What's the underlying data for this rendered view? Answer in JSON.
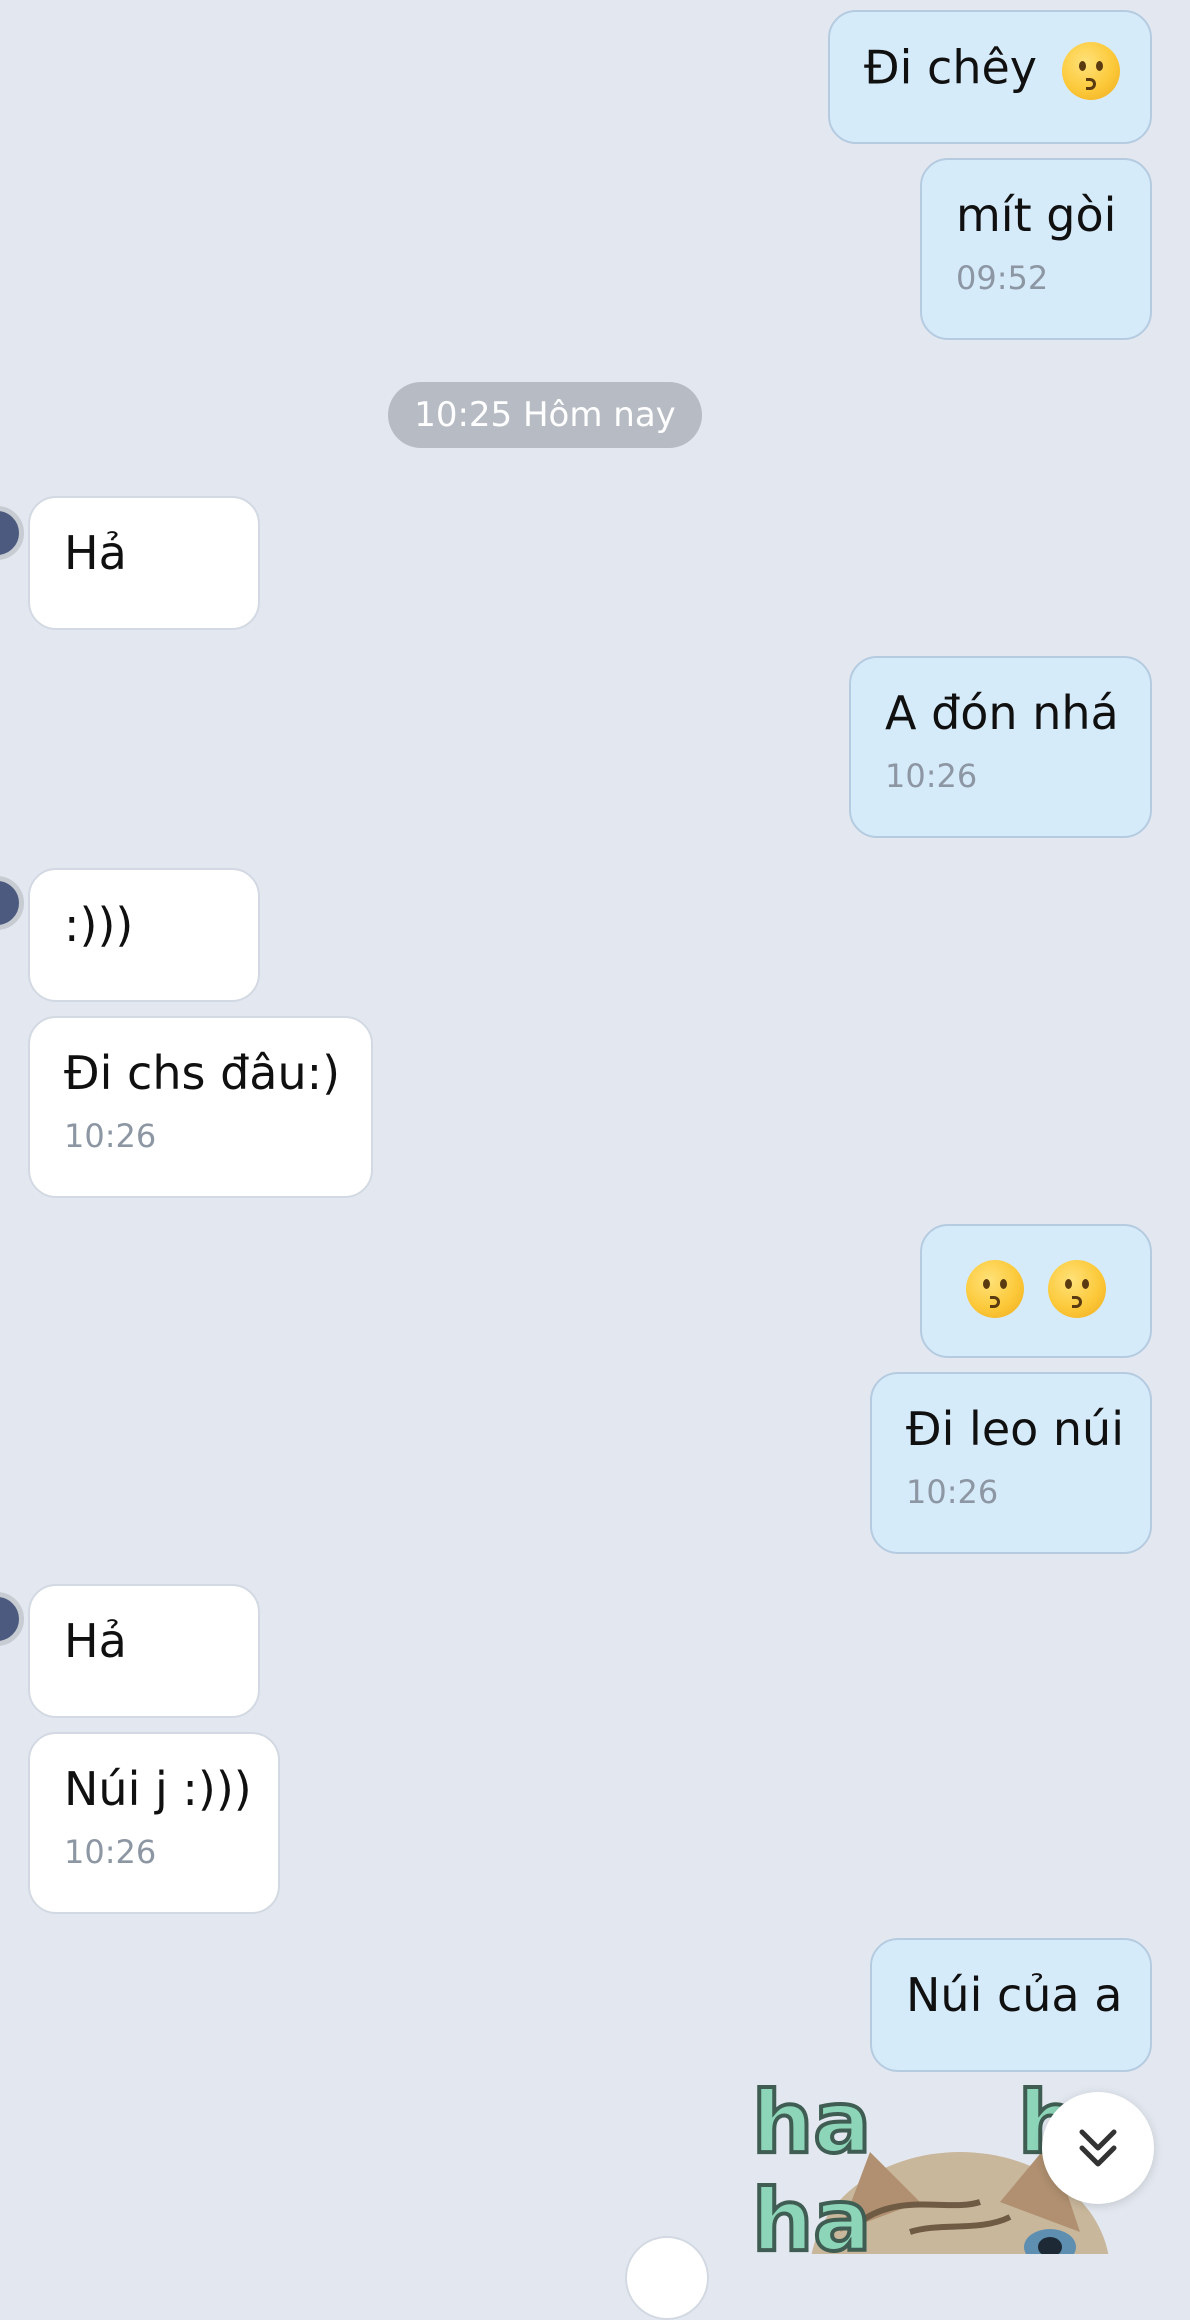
{
  "messages": {
    "m1": {
      "text": "Đi chêy"
    },
    "m2": {
      "text": "mít gòi",
      "time": "09:52"
    },
    "m3": {
      "text": "Hả"
    },
    "m4": {
      "text": "A đón nhá",
      "time": "10:26"
    },
    "m5": {
      "text": ":)))"
    },
    "m6": {
      "text": "Đi chs đâu:)",
      "time": "10:26"
    },
    "m7": {
      "emoji": [
        "kissing-face",
        "kissing-face"
      ]
    },
    "m8": {
      "text": "Đi leo núi",
      "time": "10:26"
    },
    "m9": {
      "text": "Hả"
    },
    "m10": {
      "text": "Núi j :)))",
      "time": "10:26"
    },
    "m11": {
      "text": "Núi của a"
    }
  },
  "date_separator": "10:25 Hôm nay",
  "sticker": {
    "text_lines": [
      "ha",
      "ha"
    ],
    "image": "laughing-kitten-sticker"
  },
  "icons": {
    "scroll_down": "double-chevron-down-icon",
    "emoji": "kissing-face-emoji"
  },
  "colors": {
    "background": "#e3e8f0",
    "outgoing_bubble": "#d6ebfa",
    "incoming_bubble": "#ffffff",
    "date_pill": "#b7bcc4",
    "timestamp": "#8d96a3",
    "sticker_text": "#8dd5b9"
  }
}
